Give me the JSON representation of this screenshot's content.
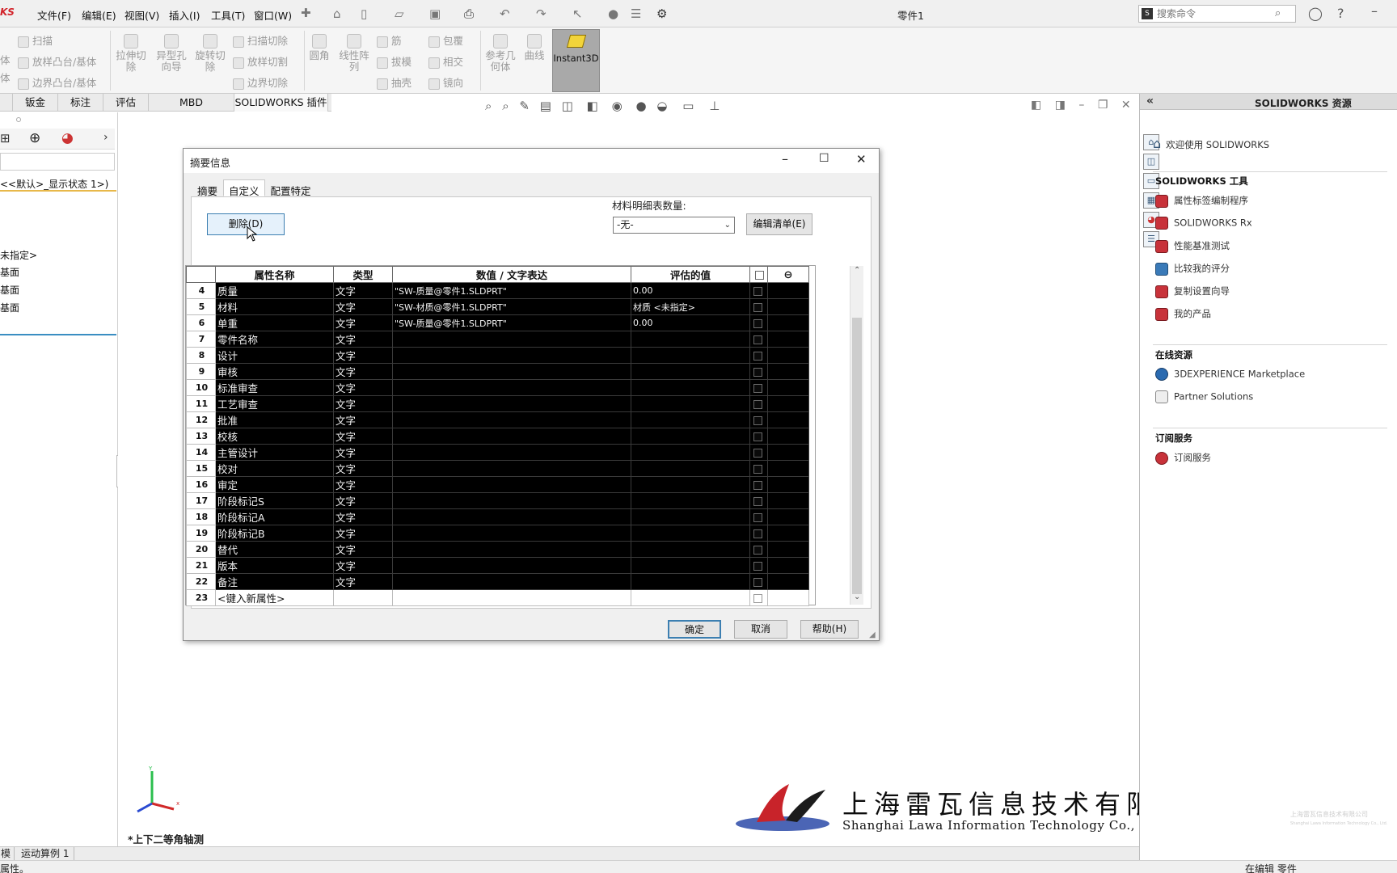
{
  "app": {
    "logo_text": "KS",
    "document_title": "零件1",
    "menus": [
      "文件(F)",
      "编辑(E)",
      "视图(V)",
      "插入(I)",
      "工具(T)",
      "窗口(W)"
    ],
    "search_placeholder": "搜索命令"
  },
  "ribbon": {
    "col1": [
      "扫描",
      "放样凸台/基体",
      "边界凸台/基体"
    ],
    "col1_left": [
      "体",
      "体"
    ],
    "big": [
      "拉伸切除",
      "异型孔向导",
      "旋转切除"
    ],
    "col2": [
      "扫描切除",
      "放样切割",
      "边界切除"
    ],
    "big2": [
      "圆角",
      "线性阵列"
    ],
    "col3": [
      "筋",
      "拔模",
      "抽壳"
    ],
    "col4": [
      "包覆",
      "相交",
      "镜向"
    ],
    "big3": [
      "参考几何体",
      "曲线"
    ],
    "instant3d": "Instant3D"
  },
  "command_tabs": [
    "钣金",
    "标注",
    "评估",
    "MBD Dimensions",
    "SOLIDWORKS 插件"
  ],
  "feature_tree": {
    "config_line": "<<默认>_显示状态 1>)",
    "items": [
      "未指定>",
      "基面",
      "基面",
      "基面"
    ]
  },
  "view": {
    "orientation_label": "*上下二等角轴测",
    "triad_x": "x",
    "triad_y": "Y"
  },
  "bottom_tabs": [
    "模型",
    "运动算例 1"
  ],
  "status": {
    "left": "属性。",
    "right": "在编辑 零件"
  },
  "watermark": {
    "company_cn": "上海雷瓦信息技术有限公司",
    "company_en": "Shanghai Lawa Information Technology Co., Ltd.",
    "small_cn": "上海雷瓦信息技术有限公司",
    "small_en": "Shanghai Lawa Information Technology Co., Ltd."
  },
  "taskpane": {
    "title": "SOLIDWORKS 资源",
    "welcome": "欢迎使用 SOLIDWORKS",
    "sections": [
      {
        "title": "SOLIDWORKS 工具",
        "items": [
          "属性标签编制程序",
          "SOLIDWORKS Rx",
          "性能基准测试",
          "比较我的评分",
          "复制设置向导",
          "我的产品"
        ]
      },
      {
        "title": "在线资源",
        "items": [
          "3DEXPERIENCE Marketplace",
          "Partner Solutions"
        ]
      },
      {
        "title": "订阅服务",
        "items": [
          "订阅服务"
        ]
      }
    ]
  },
  "dialog": {
    "title": "摘要信息",
    "tabs": [
      "摘要",
      "自定义",
      "配置特定"
    ],
    "active_tab": "自定义",
    "delete_button": "删除(D)",
    "bom_label": "材料明细表数量:",
    "bom_value": "-无-",
    "edit_list_button": "编辑清单(E)",
    "columns": [
      "属性名称",
      "类型",
      "数值 / 文字表达",
      "评估的值"
    ],
    "rows": [
      {
        "n": "4",
        "name": "质量",
        "type": "文字",
        "value": "\"SW-质量@零件1.SLDPRT\"",
        "evaluated": "0.00"
      },
      {
        "n": "5",
        "name": "材料",
        "type": "文字",
        "value": "\"SW-材质@零件1.SLDPRT\"",
        "evaluated": "材质 <未指定>"
      },
      {
        "n": "6",
        "name": "单重",
        "type": "文字",
        "value": "\"SW-质量@零件1.SLDPRT\"",
        "evaluated": "0.00"
      },
      {
        "n": "7",
        "name": "零件名称",
        "type": "文字",
        "value": "",
        "evaluated": ""
      },
      {
        "n": "8",
        "name": "设计",
        "type": "文字",
        "value": "",
        "evaluated": ""
      },
      {
        "n": "9",
        "name": "审核",
        "type": "文字",
        "value": "",
        "evaluated": ""
      },
      {
        "n": "10",
        "name": "标准审查",
        "type": "文字",
        "value": "",
        "evaluated": ""
      },
      {
        "n": "11",
        "name": "工艺审查",
        "type": "文字",
        "value": "",
        "evaluated": ""
      },
      {
        "n": "12",
        "name": "批准",
        "type": "文字",
        "value": "",
        "evaluated": ""
      },
      {
        "n": "13",
        "name": "校核",
        "type": "文字",
        "value": "",
        "evaluated": ""
      },
      {
        "n": "14",
        "name": "主管设计",
        "type": "文字",
        "value": "",
        "evaluated": ""
      },
      {
        "n": "15",
        "name": "校对",
        "type": "文字",
        "value": "",
        "evaluated": ""
      },
      {
        "n": "16",
        "name": "审定",
        "type": "文字",
        "value": "",
        "evaluated": ""
      },
      {
        "n": "17",
        "name": "阶段标记S",
        "type": "文字",
        "value": "",
        "evaluated": ""
      },
      {
        "n": "18",
        "name": "阶段标记A",
        "type": "文字",
        "value": "",
        "evaluated": ""
      },
      {
        "n": "19",
        "name": "阶段标记B",
        "type": "文字",
        "value": "",
        "evaluated": ""
      },
      {
        "n": "20",
        "name": "替代",
        "type": "文字",
        "value": "",
        "evaluated": ""
      },
      {
        "n": "21",
        "name": "版本",
        "type": "文字",
        "value": "",
        "evaluated": ""
      },
      {
        "n": "22",
        "name": "备注",
        "type": "文字",
        "value": "",
        "evaluated": ""
      }
    ],
    "new_row": {
      "n": "23",
      "name": "<键入新属性>"
    },
    "ok_button": "确定",
    "cancel_button": "取消",
    "help_button": "帮助(H)"
  },
  "colors": {
    "brand": "#d2232a",
    "accent": "#3c7fb1"
  }
}
